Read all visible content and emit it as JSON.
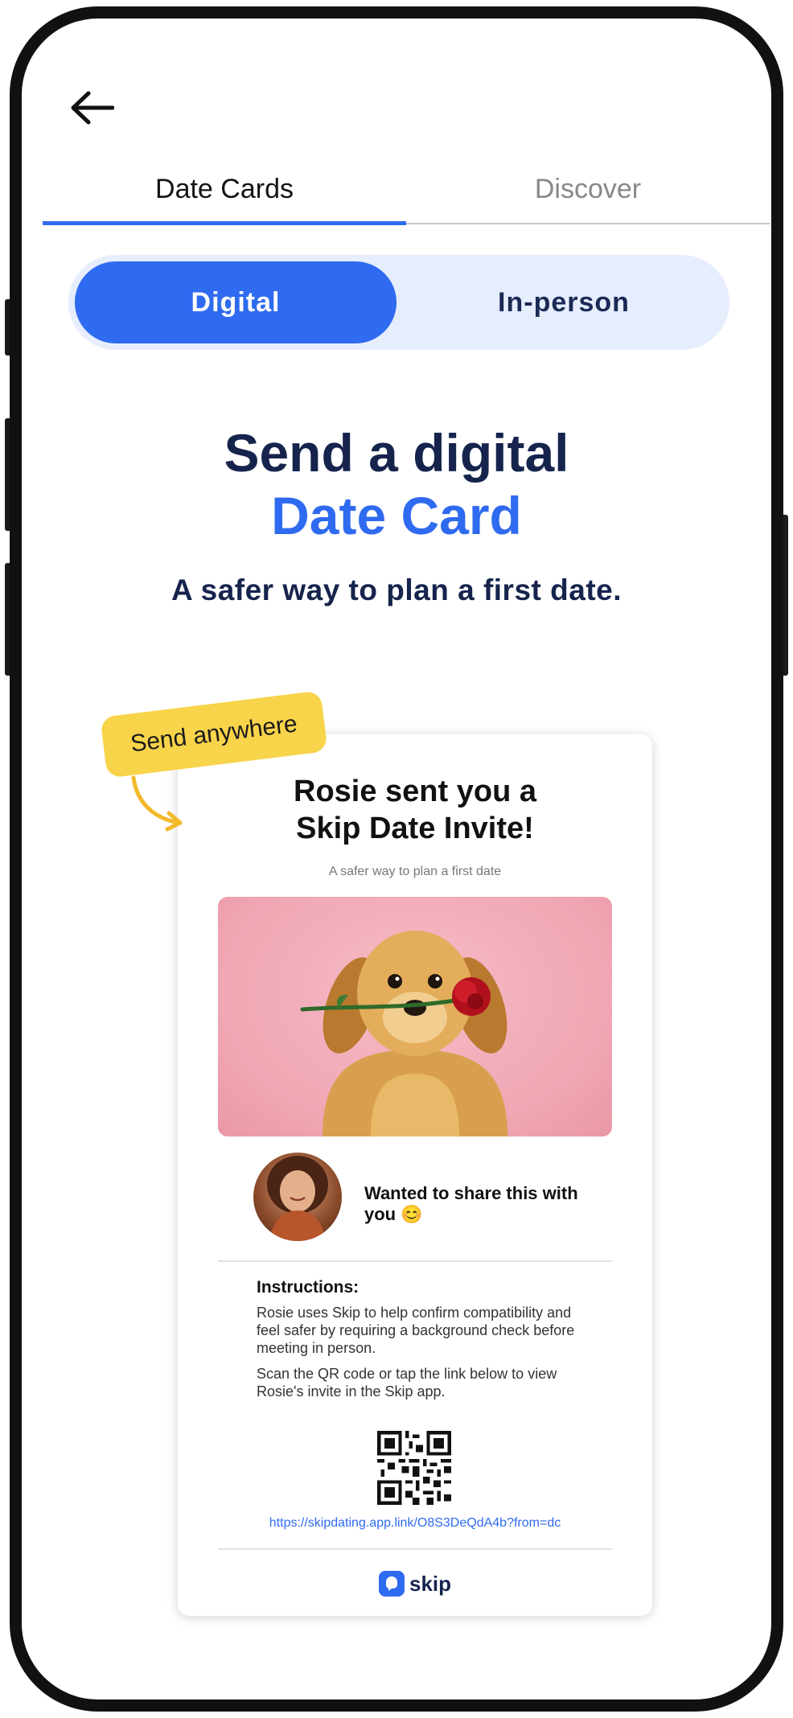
{
  "header": {
    "back_icon": "arrow-left-icon"
  },
  "tabs": [
    {
      "label": "Date Cards",
      "active": true
    },
    {
      "label": "Discover",
      "active": false
    }
  ],
  "segment": {
    "digital": "Digital",
    "inperson": "In-person",
    "selected": "Digital"
  },
  "hero": {
    "title_line1": "Send a digital",
    "title_line2": "Date Card",
    "subtitle": "A safer way to plan a first date."
  },
  "sticker": {
    "label": "Send anywhere"
  },
  "card": {
    "title_line1": "Rosie sent you a",
    "title_line2": "Skip Date Invite!",
    "subtitle": "A safer way to plan a first date",
    "message": "Wanted to share this with you 😊",
    "instructions_title": "Instructions:",
    "instructions_p1": "Rosie uses Skip to help confirm compatibility and feel safer by requiring a background check before meeting in person.",
    "instructions_p2": "Scan the QR code or tap the link below to view Rosie's invite in the Skip app.",
    "link": "https://skipdating.app.link/O8S3DeQdA4b?from=dc",
    "brand": "skip"
  },
  "colors": {
    "accent": "#2f6bf0",
    "navy": "#16244d",
    "sticker": "#f8d44a",
    "segment_bg": "#e6edfd"
  }
}
